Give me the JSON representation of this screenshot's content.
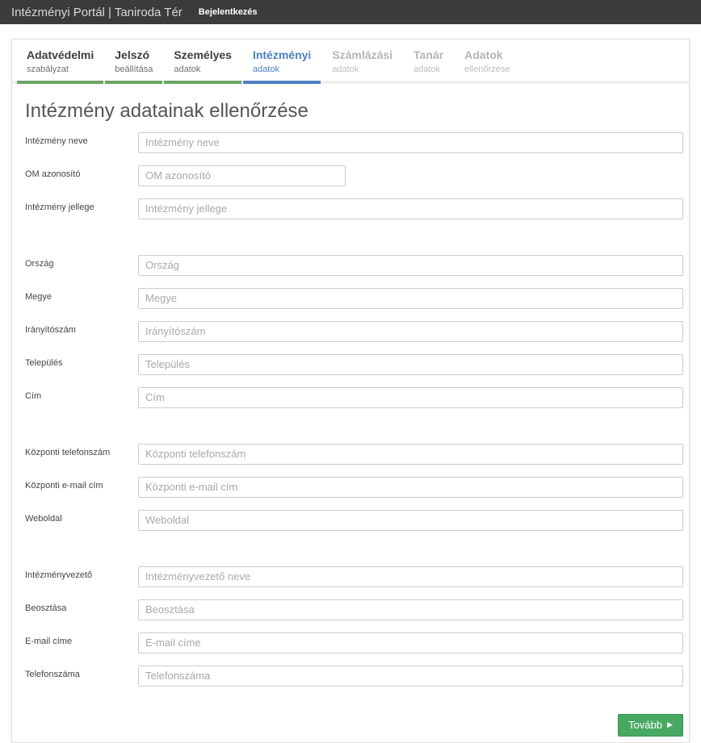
{
  "topbar": {
    "title": "Intézményi Portál | Taniroda Tér",
    "login_label": "Bejelentkezés"
  },
  "tabs": [
    {
      "line1": "Adatvédelmi",
      "line2": "szabályzat",
      "state": "done"
    },
    {
      "line1": "Jelszó",
      "line2": "beállítása",
      "state": "done"
    },
    {
      "line1": "Személyes",
      "line2": "adatok",
      "state": "done"
    },
    {
      "line1": "Intézményi",
      "line2": "adatok",
      "state": "active"
    },
    {
      "line1": "Számlázási",
      "line2": "adatok",
      "state": "upcoming"
    },
    {
      "line1": "Tanár",
      "line2": "adatok",
      "state": "upcoming"
    },
    {
      "line1": "Adatok",
      "line2": "ellenőrzése",
      "state": "upcoming"
    }
  ],
  "page_title": "Intézmény adatainak ellenőrzése",
  "form": {
    "fields": [
      {
        "label": "Intézmény neve",
        "placeholder": "Intézmény neve",
        "value": ""
      },
      {
        "label": "OM azonosító",
        "placeholder": "OM azonosító",
        "value": ""
      },
      {
        "label": "Intézmény jellege",
        "placeholder": "Intézmény jellege",
        "value": ""
      },
      {
        "label": "Ország",
        "placeholder": "Ország",
        "value": ""
      },
      {
        "label": "Megye",
        "placeholder": "Megye",
        "value": ""
      },
      {
        "label": "Irányítószám",
        "placeholder": "Irányítószám",
        "value": ""
      },
      {
        "label": "Település",
        "placeholder": "Település",
        "value": ""
      },
      {
        "label": "Cím",
        "placeholder": "Cím",
        "value": ""
      },
      {
        "label": "Központi telefonszám",
        "placeholder": "Központi telefonszám",
        "value": ""
      },
      {
        "label": "Központi e-mail cím",
        "placeholder": "Központi e-mail cím",
        "value": ""
      },
      {
        "label": "Weboldal",
        "placeholder": "Weboldal",
        "value": ""
      },
      {
        "label": "Intézményvezető",
        "placeholder": "Intézményvezető neve",
        "value": ""
      },
      {
        "label": "Beosztása",
        "placeholder": "Beosztása",
        "value": ""
      },
      {
        "label": "E-mail címe",
        "placeholder": "E-mail címe",
        "value": ""
      },
      {
        "label": "Telefonszáma",
        "placeholder": "Telefonszáma",
        "value": ""
      }
    ]
  },
  "next_button": {
    "label": "Tovább",
    "icon_glyph": "▶"
  },
  "colors": {
    "topbar_bg": "#3b3b3b",
    "accent_green": "#6aa564",
    "accent_blue": "#4d7fc0",
    "button_green": "#47a862"
  }
}
